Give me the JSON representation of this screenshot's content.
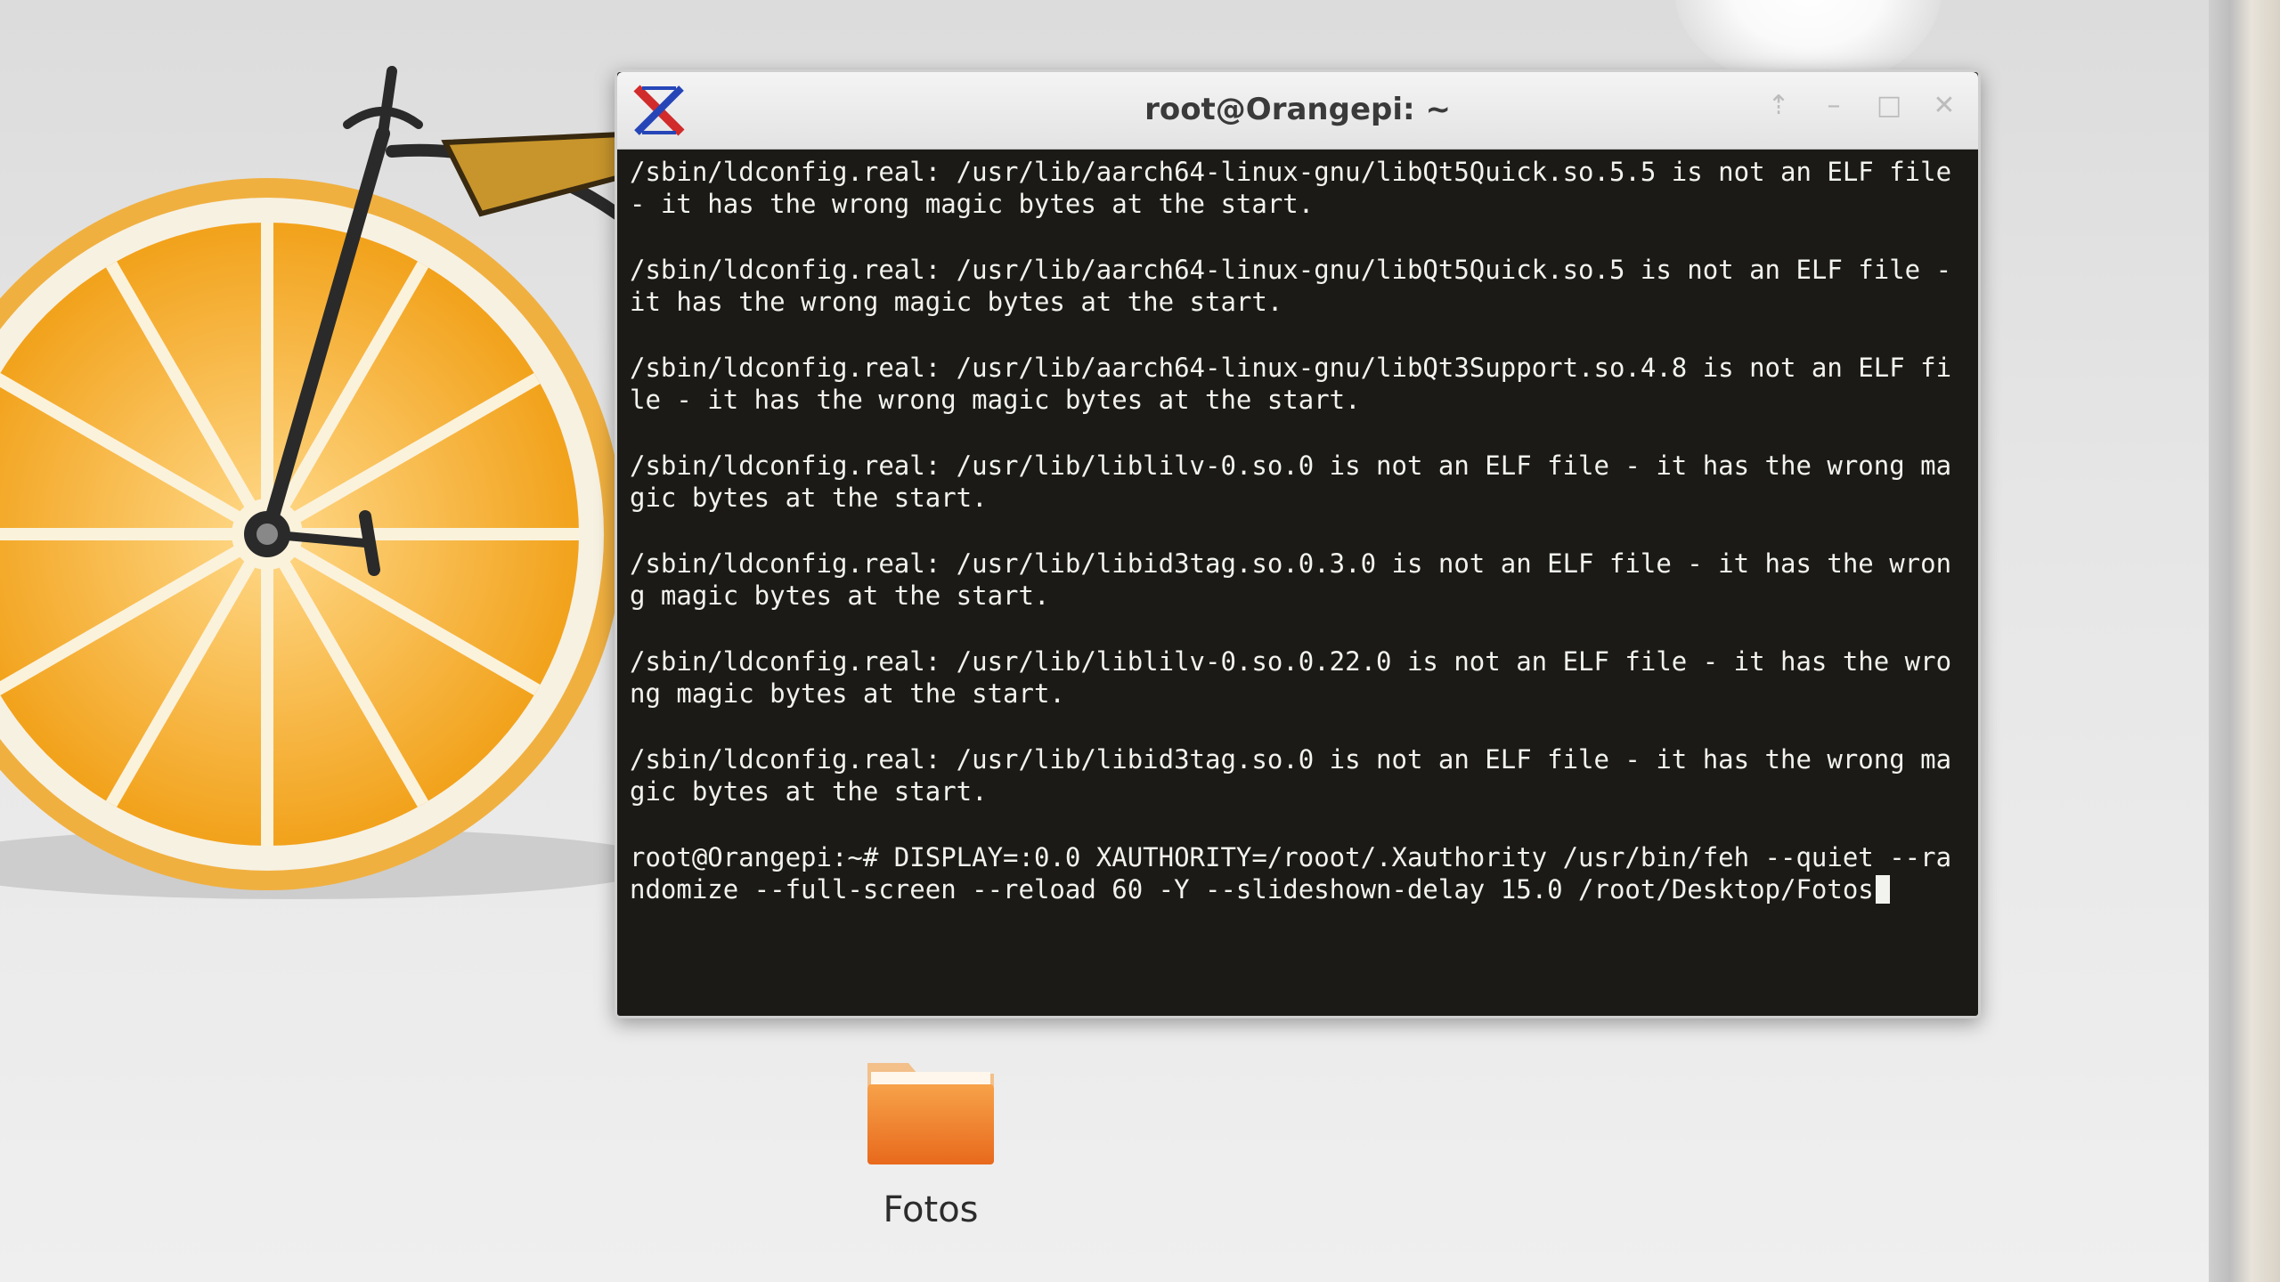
{
  "colors": {
    "terminal_bg": "#1b1a16",
    "terminal_fg": "#f2f2ee",
    "orange": "#f5a623",
    "titlebar": "#e9e9e9"
  },
  "terminal": {
    "title": "root@Orangepi: ~",
    "icon": "xterm-icon",
    "controls": [
      {
        "name": "up-icon",
        "glyph": "⇡"
      },
      {
        "name": "minimize-icon",
        "glyph": "–"
      },
      {
        "name": "maximize-icon",
        "glyph": "□"
      },
      {
        "name": "close-icon",
        "glyph": "✕"
      }
    ],
    "messages": [
      "/sbin/ldconfig.real: /usr/lib/aarch64-linux-gnu/libQt5Quick.so.5.5 is not an ELF file - it has the wrong magic bytes at the start.",
      "/sbin/ldconfig.real: /usr/lib/aarch64-linux-gnu/libQt5Quick.so.5 is not an ELF file - it has the wrong magic bytes at the start.",
      "/sbin/ldconfig.real: /usr/lib/aarch64-linux-gnu/libQt3Support.so.4.8 is not an ELF file - it has the wrong magic bytes at the start.",
      "/sbin/ldconfig.real: /usr/lib/liblilv-0.so.0 is not an ELF file - it has the wrong magic bytes at the start.",
      "/sbin/ldconfig.real: /usr/lib/libid3tag.so.0.3.0 is not an ELF file - it has the wrong magic bytes at the start.",
      "/sbin/ldconfig.real: /usr/lib/liblilv-0.so.0.22.0 is not an ELF file - it has the wrong magic bytes at the start.",
      "/sbin/ldconfig.real: /usr/lib/libid3tag.so.0 is not an ELF file - it has the wrong magic bytes at the start."
    ],
    "prompt_line": "root@Orangepi:~# DISPLAY=:0.0 XAUTHORITY=/rooot/.Xauthority /usr/bin/feh --quiet --randomize --full-screen --reload 60 -Y --slideshown-delay 15.0 /root/Desktop/Fotos"
  },
  "desktop": {
    "folder_label": "Fotos",
    "folder_icon": "folder-icon"
  }
}
